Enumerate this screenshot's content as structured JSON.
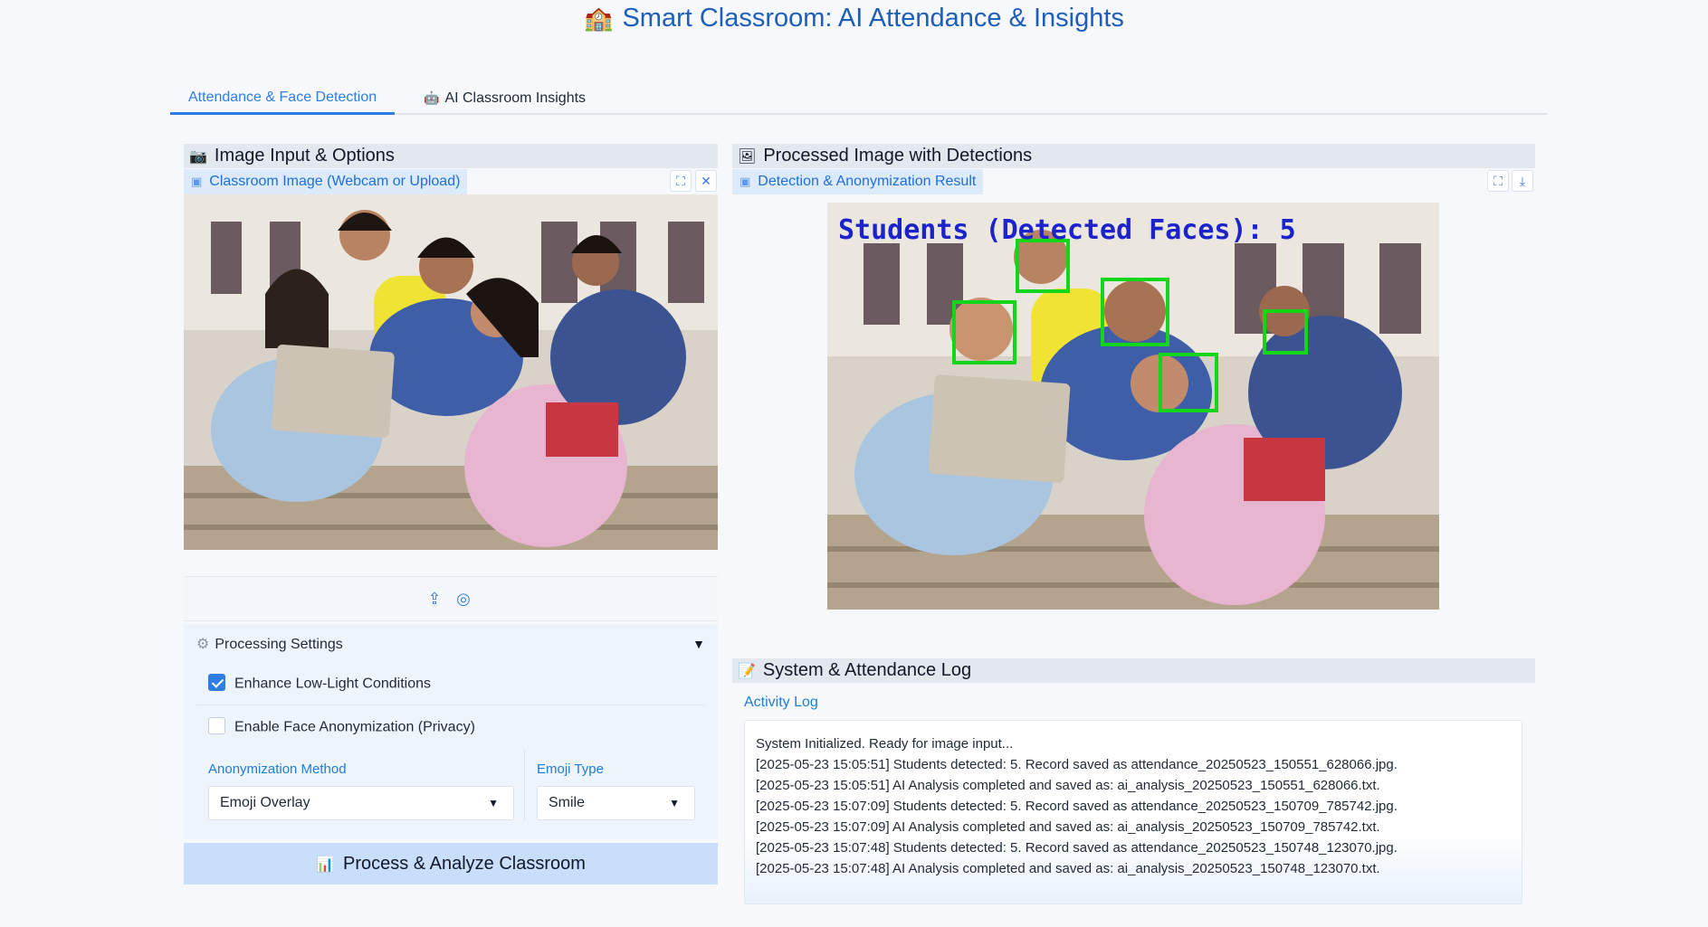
{
  "header": {
    "emoji": "🏫",
    "title": "Smart Classroom: AI Attendance & Insights"
  },
  "tabs": [
    {
      "label": "Attendance & Face Detection",
      "active": true
    },
    {
      "label": "AI Classroom Insights",
      "icon": "robot-icon",
      "active": false
    }
  ],
  "left_panel": {
    "title": "Image Input & Options",
    "title_icon": "camera-icon",
    "image_label": "Classroom Image (Webcam or Upload)",
    "upload_icons": [
      "upload-icon",
      "webcam-icon"
    ],
    "settings": {
      "title": "Processing Settings",
      "enhance_label": "Enhance Low-Light Conditions",
      "enhance_checked": true,
      "anonymize_label": "Enable Face Anonymization (Privacy)",
      "anonymize_checked": false,
      "method_label": "Anonymization Method",
      "method_value": "Emoji Overlay",
      "emoji_label": "Emoji Type",
      "emoji_value": "Smile"
    },
    "process_button": "Process & Analyze Classroom"
  },
  "right_panel": {
    "title": "Processed Image with Detections",
    "result_label": "Detection & Anonymization Result",
    "overlay_text": "Students (Detected Faces): 5",
    "face_boxes_color": "#12d61a",
    "overlay_color": "#1b23c9"
  },
  "log_panel": {
    "title": "System & Attendance Log",
    "activity_label": "Activity Log",
    "lines": [
      "System Initialized. Ready for image input...",
      "[2025-05-23 15:05:51] Students detected: 5. Record saved as attendance_20250523_150551_628066.jpg.",
      "[2025-05-23 15:05:51] AI Analysis completed and saved as: ai_analysis_20250523_150551_628066.txt.",
      "[2025-05-23 15:07:09] Students detected: 5. Record saved as attendance_20250523_150709_785742.jpg.",
      "[2025-05-23 15:07:09] AI Analysis completed and saved as: ai_analysis_20250523_150709_785742.txt.",
      "[2025-05-23 15:07:48] Students detected: 5. Record saved as attendance_20250523_150748_123070.jpg.",
      "[2025-05-23 15:07:48] AI Analysis completed and saved as: ai_analysis_20250523_150748_123070.txt."
    ]
  },
  "colors": {
    "accent": "#2f7de1",
    "title": "#1d5fb8",
    "panel_header": "#e3e8ef"
  }
}
